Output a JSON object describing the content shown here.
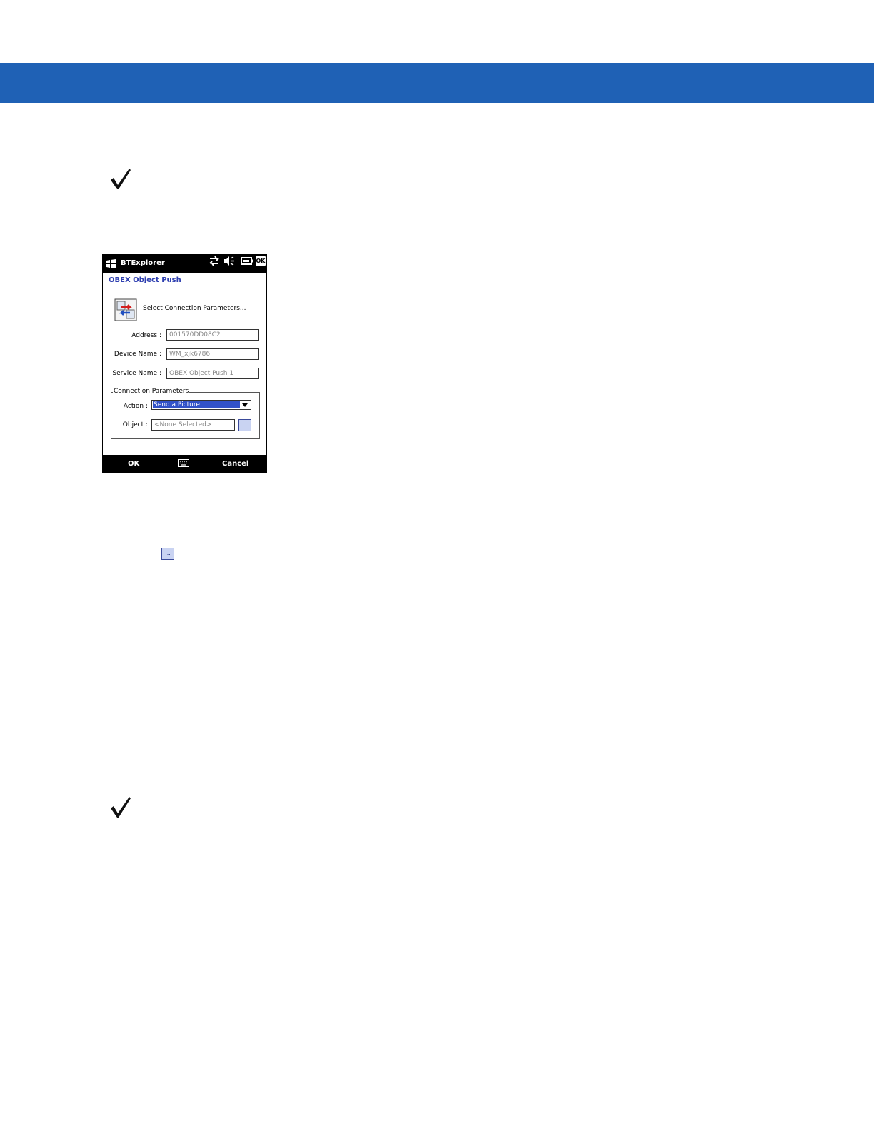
{
  "colors": {
    "header_band": "#1f61b5",
    "dialog_title": "#2e3fb0",
    "selection": "#3252c8",
    "browse_button": "#c9d3f2"
  },
  "notes": [
    {
      "icon": "checkmark-icon"
    },
    {
      "icon": "checkmark-icon"
    }
  ],
  "device": {
    "app_title": "BTExplorer",
    "status_icons": [
      "connectivity-icon",
      "speaker-muted-icon",
      "battery-icon"
    ],
    "ok_label": "OK",
    "dialog_title": "OBEX Object Push",
    "prompt": "Select Connection Parameters...",
    "fields": {
      "address": {
        "label": "Address :",
        "value": "001570DD08C2"
      },
      "device_name": {
        "label": "Device Name :",
        "value": "WM_xjk6786"
      },
      "service_name": {
        "label": "Service Name :",
        "value": "OBEX Object Push 1"
      }
    },
    "group": {
      "legend": "Connection Parameters",
      "action_label": "Action :",
      "action_value": "Send a Picture",
      "object_label": "Object :",
      "object_value": "<None Selected>",
      "browse_label": "..."
    },
    "softkeys": {
      "left": "OK",
      "right": "Cancel"
    }
  },
  "inline_browse_label": "..."
}
